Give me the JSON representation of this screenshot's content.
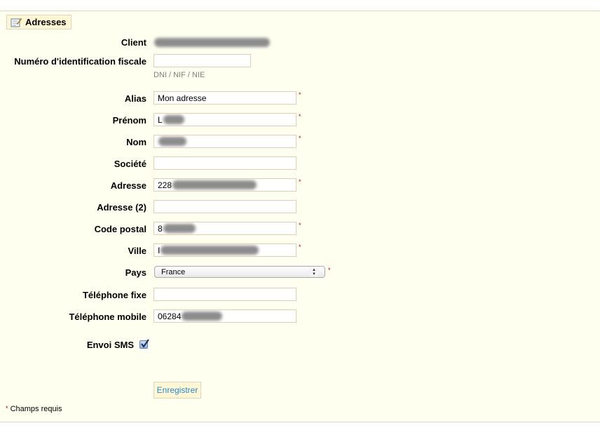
{
  "section": {
    "title": "Adresses",
    "icon": "edit-document-icon"
  },
  "form": {
    "client_label": "Client",
    "tax_label": "Numéro d'identification fiscale",
    "tax_value": "",
    "tax_hint": "DNI / NIF / NIE",
    "alias_label": "Alias",
    "alias_value": "Mon adresse",
    "firstname_label": "Prénom",
    "firstname_value": "L",
    "lastname_label": "Nom",
    "lastname_value": "",
    "company_label": "Société",
    "company_value": "",
    "address1_label": "Adresse",
    "address1_value": "228",
    "address2_label": "Adresse (2)",
    "address2_value": "",
    "postcode_label": "Code postal",
    "postcode_value": "8",
    "city_label": "Ville",
    "city_value": "I",
    "country_label": "Pays",
    "country_value": "France",
    "phone_label": "Téléphone fixe",
    "phone_value": "",
    "mobile_label": "Téléphone mobile",
    "mobile_value": "06284",
    "sms_label": "Envoi SMS",
    "sms_checked": true,
    "required_marker": "*",
    "save_label": "Enregistrer",
    "required_note": "Champs requis"
  },
  "colors": {
    "panel_bg": "#fffff0",
    "border": "#dfd5c3",
    "required": "#cc0000",
    "button_text": "#268ccd"
  }
}
